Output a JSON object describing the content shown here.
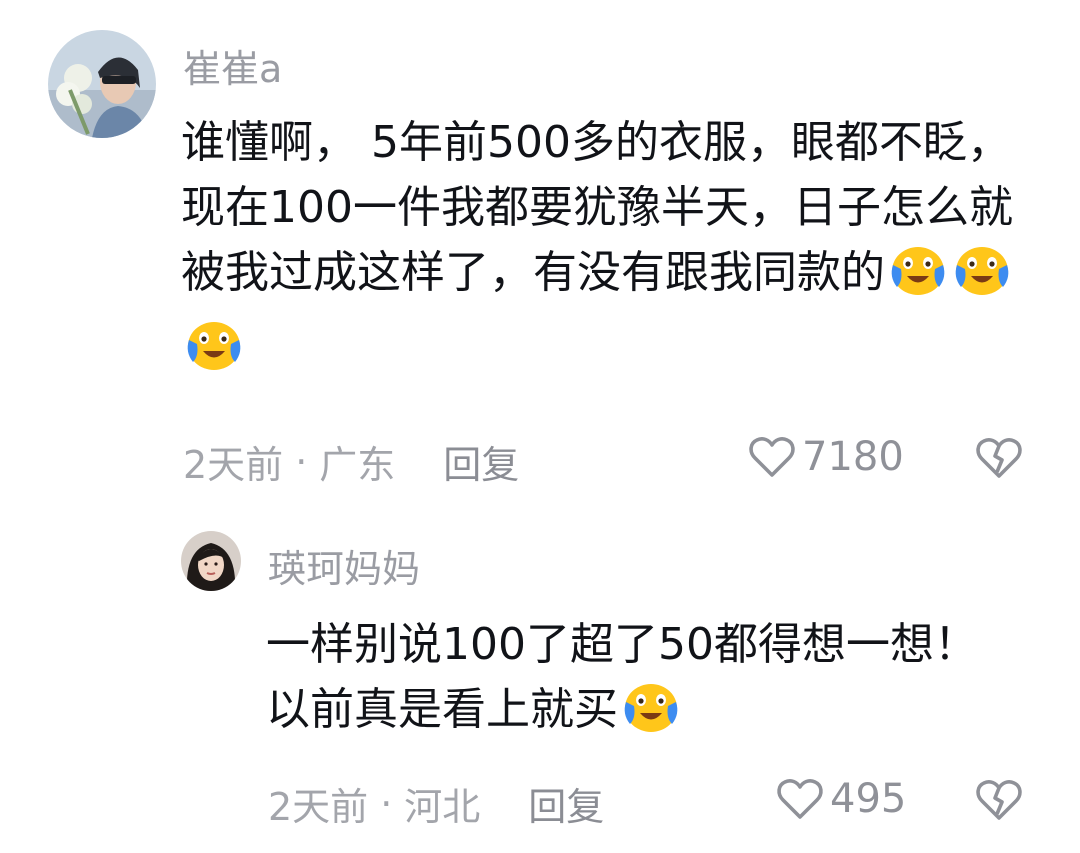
{
  "comments": [
    {
      "username": "崔崔a",
      "text": "谁懂啊， 5年前500多的衣服，眼都不眨，现在100一件我都要犹豫半天，日子怎么就被我过成这样了，有没有跟我同款的",
      "emoji_count": 3,
      "emoji_icon": "crying-laughing-emoji",
      "time": "2天前",
      "location": "广东",
      "separator": "·",
      "reply_label": "回复",
      "likes": "7180"
    },
    {
      "username": "瑛珂妈妈",
      "text": "一样别说100了超了50都得想一想！以前真是看上就买",
      "emoji_count": 1,
      "emoji_icon": "crying-laughing-emoji",
      "time": "2天前",
      "location": "河北",
      "separator": "·",
      "reply_label": "回复",
      "likes": "495"
    }
  ],
  "icons": {
    "like": "heart-outline-icon",
    "dislike": "broken-heart-icon"
  },
  "colors": {
    "text": "#111318",
    "meta": "#a3a5ab",
    "username": "#9a9ca3",
    "emoji_face": "#ffc61a",
    "emoji_tear": "#3d8cf0"
  }
}
